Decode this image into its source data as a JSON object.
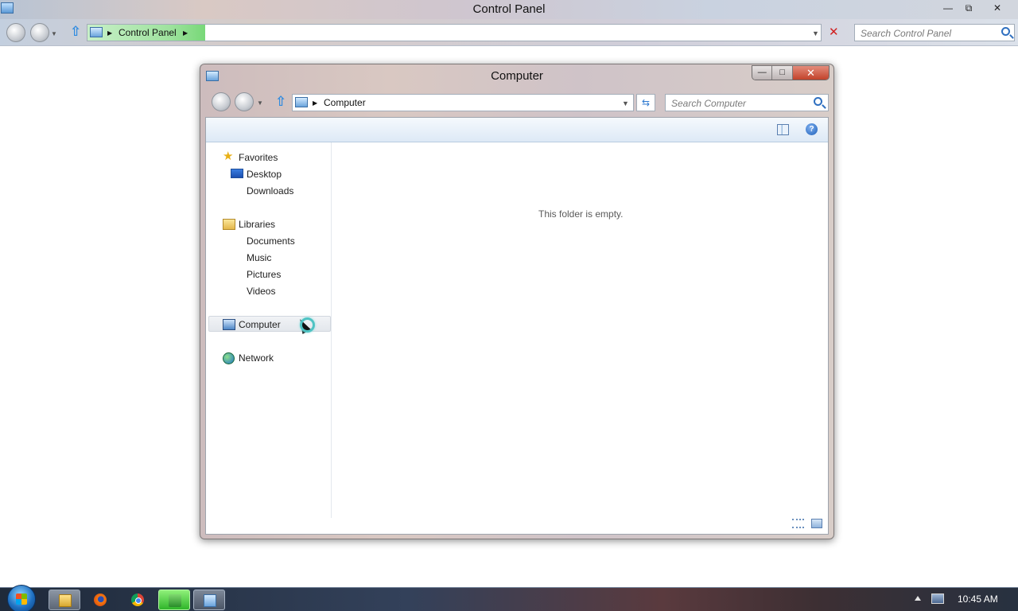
{
  "outer_window": {
    "title": "Control Panel",
    "breadcrumb": [
      "Control Panel"
    ],
    "search_placeholder": "Search Control Panel",
    "caption_buttons": {
      "minimize": "—",
      "maximize": "⧉",
      "close": "✕"
    }
  },
  "computer_window": {
    "title": "Computer",
    "breadcrumb": [
      "Computer"
    ],
    "search_placeholder": "Search Computer",
    "caption_buttons": {
      "minimize": "—",
      "maximize": "□",
      "close": "✕"
    },
    "empty_message": "This folder is empty.",
    "nav": {
      "favorites": {
        "label": "Favorites",
        "items": [
          "Desktop",
          "Downloads"
        ]
      },
      "libraries": {
        "label": "Libraries",
        "items": [
          "Documents",
          "Music",
          "Pictures",
          "Videos"
        ]
      },
      "computer": {
        "label": "Computer"
      },
      "network": {
        "label": "Network"
      }
    },
    "selected_nav_item": "Computer",
    "cursor_state": "busy"
  },
  "taskbar": {
    "pinned": [
      "windows-explorer",
      "firefox",
      "chrome",
      "green-app",
      "control-panel"
    ],
    "active": [
      "green-app",
      "control-panel"
    ],
    "clock": "10:45 AM"
  },
  "icons": {
    "favorites": "star-icon",
    "desktop": "desktop-icon",
    "libraries": "libraries-icon",
    "computer": "computer-icon",
    "network": "network-icon",
    "help": "help-icon",
    "preview_pane": "preview-pane-icon"
  },
  "colors": {
    "address_highlight": "#9ee29e",
    "close_button": "#c2432b",
    "taskbar_active_green": "#2fb52a"
  }
}
